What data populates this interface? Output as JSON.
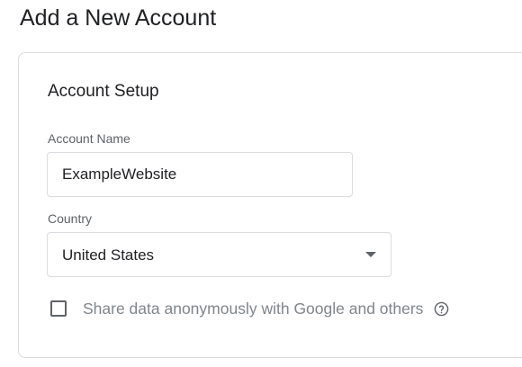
{
  "page": {
    "title": "Add a New Account"
  },
  "account_setup": {
    "title": "Account Setup",
    "account_name": {
      "label": "Account Name",
      "value": "ExampleWebsite"
    },
    "country": {
      "label": "Country",
      "selected": "United States"
    },
    "share_data": {
      "label": "Share data anonymously with Google and others",
      "checked": false,
      "help_icon": "help-circle-icon"
    }
  },
  "colors": {
    "border": "#dadce0",
    "text_primary": "#202124",
    "text_secondary": "#5f6368",
    "text_muted": "#80868b"
  }
}
